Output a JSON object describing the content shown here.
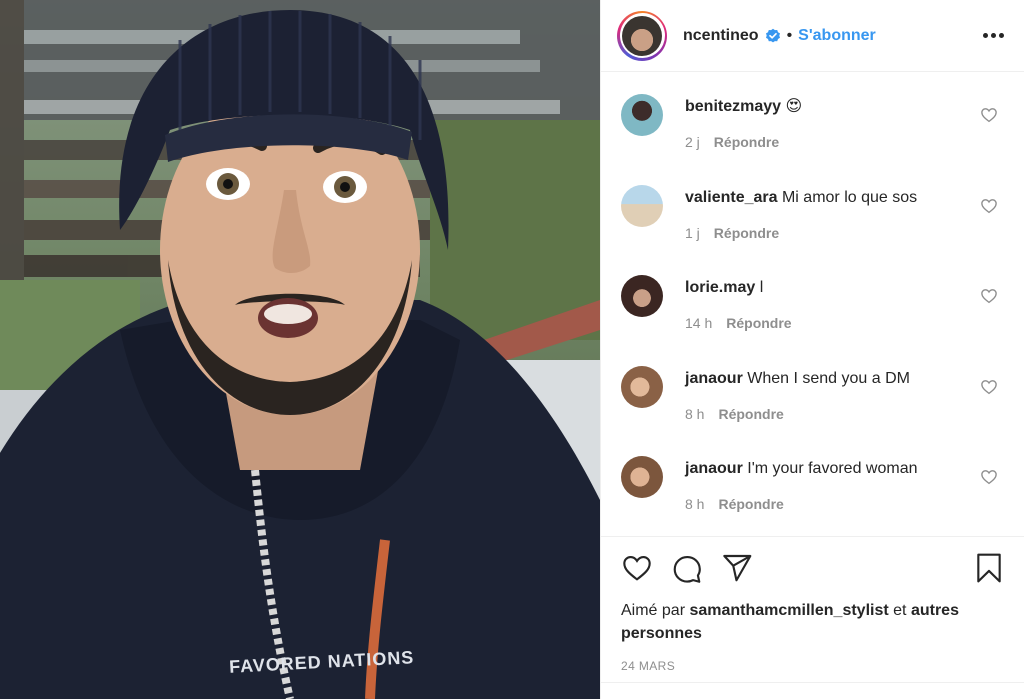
{
  "post": {
    "username": "ncentineo",
    "separator": "•",
    "follow_label": "S'abonner",
    "shirt_text": "FAVORED NATIONS"
  },
  "comments": [
    {
      "user": "benitezmayy",
      "text": "😍",
      "time": "2 j",
      "reply": "Répondre",
      "avatar_color": "#7fb8c4"
    },
    {
      "user": "valiente_ara",
      "text": "Mi amor lo que sos",
      "time": "1 j",
      "reply": "Répondre",
      "avatar_color": "#9fc3d9"
    },
    {
      "user": "lorie.may",
      "text": "l",
      "time": "14 h",
      "reply": "Répondre",
      "avatar_color": "#5b3b33"
    },
    {
      "user": "janaour",
      "text": "When I send you a DM",
      "time": "8 h",
      "reply": "Répondre",
      "avatar_color": "#c79a7a"
    },
    {
      "user": "janaour",
      "text": "I'm your favored woman",
      "time": "8 h",
      "reply": "Répondre",
      "avatar_color": "#b98d6e"
    }
  ],
  "likes": {
    "prefix": "Aimé par",
    "user": "samanthamcmillen_stylist",
    "suffix": "et",
    "others": "autres personnes"
  },
  "date": "24 MARS",
  "colors": {
    "link_blue": "#3897f0",
    "text": "#262626",
    "muted": "#8e8e8e",
    "border": "#efefef",
    "hoodie": "#1c2233"
  },
  "icons": [
    "verified-badge-icon",
    "more-options-icon",
    "heart-icon",
    "comment-icon",
    "share-icon",
    "bookmark-icon"
  ]
}
